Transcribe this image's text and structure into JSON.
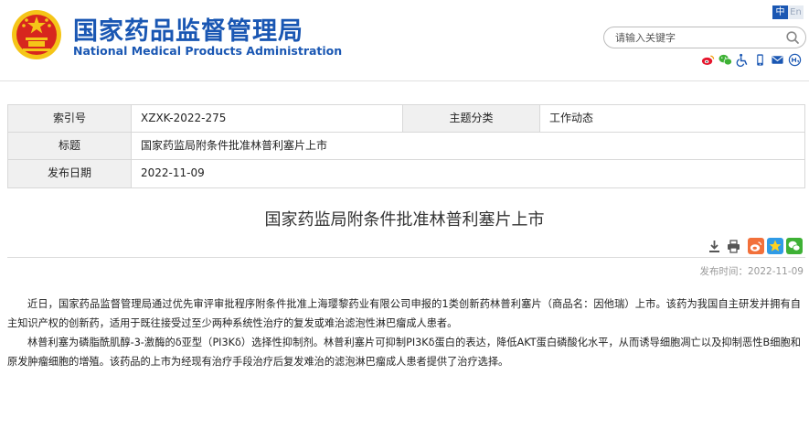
{
  "header": {
    "logo_cn": "国家药品监督管理局",
    "logo_en": "National Medical Products Administration",
    "lang": {
      "zh": "中",
      "en": "En"
    },
    "search_placeholder": "请输入关键字",
    "tool_icons": [
      "weibo-icon",
      "wechat-icon",
      "accessibility-icon",
      "mobile-icon",
      "mail-icon",
      "elder-mode-icon"
    ]
  },
  "info": {
    "index_label": "索引号",
    "index_value": "XZXK-2022-275",
    "category_label": "主题分类",
    "category_value": "工作动态",
    "title_label": "标题",
    "title_value": "国家药监局附条件批准林普利塞片上市",
    "date_label": "发布日期",
    "date_value": "2022-11-09"
  },
  "article": {
    "title": "国家药监局附条件批准林普利塞片上市",
    "pubdate": "发布时间：2022-11-09",
    "paragraphs": [
      "近日，国家药品监督管理局通过优先审评审批程序附条件批准上海璎黎药业有限公司申报的1类创新药林普利塞片（商品名：因他瑞）上市。该药为我国自主研发并拥有自主知识产权的创新药，适用于既往接受过至少两种系统性治疗的复发或难治滤泡性淋巴瘤成人患者。",
      "林普利塞为磷脂酰肌醇-3-激酶的δ亚型（PI3Kδ）选择性抑制剂。林普利塞片可抑制PI3Kδ蛋白的表达，降低AKT蛋白磷酸化水平，从而诱导细胞凋亡以及抑制恶性B细胞和原发肿瘤细胞的增殖。该药品的上市为经现有治疗手段治疗后复发难治的滤泡淋巴瘤成人患者提供了治疗选择。"
    ]
  },
  "colors": {
    "brand_blue": "#1a57b3",
    "emblem_red": "#d7261e",
    "emblem_gold": "#f5c518"
  }
}
